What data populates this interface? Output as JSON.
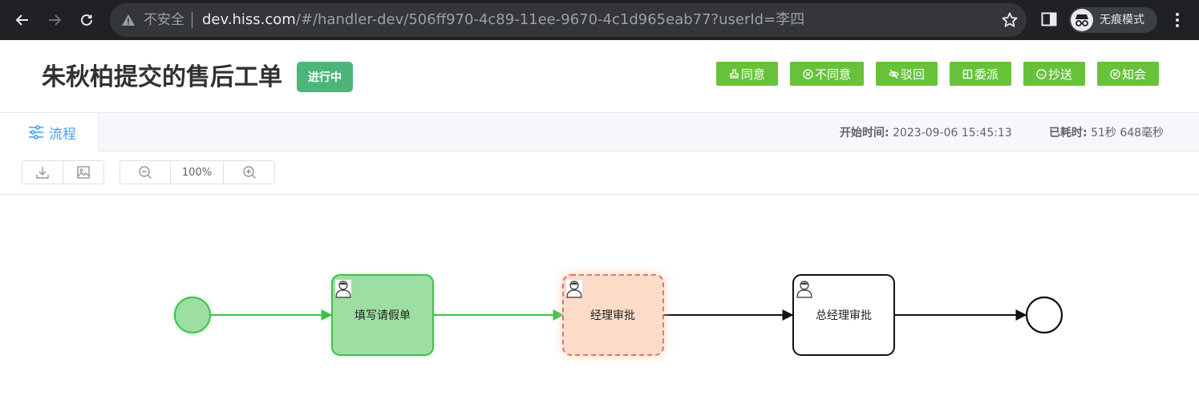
{
  "browser": {
    "security_label": "不安全",
    "url_host": "dev.hiss.com",
    "url_path": "/#/handler-dev/506ff970-4c89-11ee-9670-4c1d965eab77?userId=李四",
    "incognito_label": "无痕模式"
  },
  "header": {
    "title": "朱秋柏提交的售后工单",
    "status": "进行中",
    "actions": [
      {
        "label": "同意",
        "icon": "stamp-icon"
      },
      {
        "label": "不同意",
        "icon": "x-circle-icon"
      },
      {
        "label": "驳回",
        "icon": "eye-off-icon"
      },
      {
        "label": "委派",
        "icon": "grid-icon"
      },
      {
        "label": "抄送",
        "icon": "cc-icon"
      },
      {
        "label": "知会",
        "icon": "x-circle-icon"
      }
    ],
    "accent_color": "#67c23a"
  },
  "tabs": {
    "active_label": "流程",
    "start_time_label": "开始时间:",
    "start_time_value": "2023-09-06 15:45:13",
    "elapsed_label": "已耗时:",
    "elapsed_value": "51秒 648毫秒"
  },
  "toolbar": {
    "zoom": "100%"
  },
  "flow": {
    "nodes": [
      {
        "type": "start",
        "status": "completed"
      },
      {
        "type": "user-task",
        "label": "填写请假单",
        "status": "completed"
      },
      {
        "type": "user-task",
        "label": "经理审批",
        "status": "active"
      },
      {
        "type": "user-task",
        "label": "总经理审批",
        "status": "pending"
      },
      {
        "type": "end",
        "status": "pending"
      }
    ],
    "colors": {
      "completed_fill": "#9ddfa2",
      "completed_stroke": "#3cc24a",
      "active_fill": "#fbdcc8",
      "active_stroke": "#e8706a",
      "pending_stroke": "#111111"
    }
  }
}
